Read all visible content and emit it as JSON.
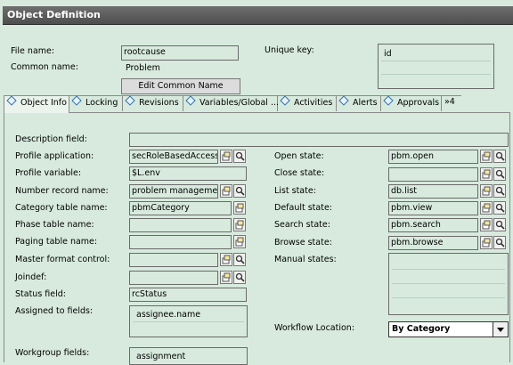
{
  "window": {
    "title": "Object Definition"
  },
  "header": {
    "file_name_label": "File name:",
    "file_name_value": "rootcause",
    "common_name_label": "Common name:",
    "common_name_value": "Problem",
    "unique_key_label": "Unique key:",
    "unique_key_value": "id",
    "edit_button": "Edit Common Name"
  },
  "tabs": [
    {
      "label": "Object Info"
    },
    {
      "label": "Locking"
    },
    {
      "label": "Revisions"
    },
    {
      "label": "Variables/Global ..."
    },
    {
      "label": "Activities"
    },
    {
      "label": "Alerts"
    },
    {
      "label": "Approvals"
    },
    {
      "label": "»4"
    }
  ],
  "form": {
    "description_label": "Description field:",
    "profile_app_label": "Profile application:",
    "profile_app_value": "secRoleBasedAccess",
    "profile_var_label": "Profile variable:",
    "profile_var_value": "$L.env",
    "number_record_label": "Number record name:",
    "number_record_value": "problem management",
    "category_table_label": "Category table name:",
    "category_table_value": "pbmCategory",
    "phase_table_label": "Phase table name:",
    "paging_table_label": "Paging table name:",
    "master_format_label": "Master format control:",
    "joindef_label": "Joindef:",
    "status_field_label": "Status field:",
    "status_field_value": "rcStatus",
    "assigned_label": "Assigned to fields:",
    "assigned_value": "assignee.name",
    "workgroup_label": "Workgroup fields:",
    "workgroup_value": "assignment",
    "open_state_label": "Open state:",
    "open_state_value": "pbm.open",
    "close_state_label": "Close state:",
    "list_state_label": "List state:",
    "list_state_value": "db.list",
    "default_state_label": "Default state:",
    "default_state_value": "pbm.view",
    "search_state_label": "Search state:",
    "search_state_value": "pbm.search",
    "browse_state_label": "Browse state:",
    "browse_state_value": "pbm.browse",
    "manual_states_label": "Manual states:",
    "workflow_location_label": "Workflow Location:",
    "workflow_location_value": "By Category"
  },
  "icons": {
    "browse": "browse-icon",
    "search": "magnifier-icon"
  }
}
